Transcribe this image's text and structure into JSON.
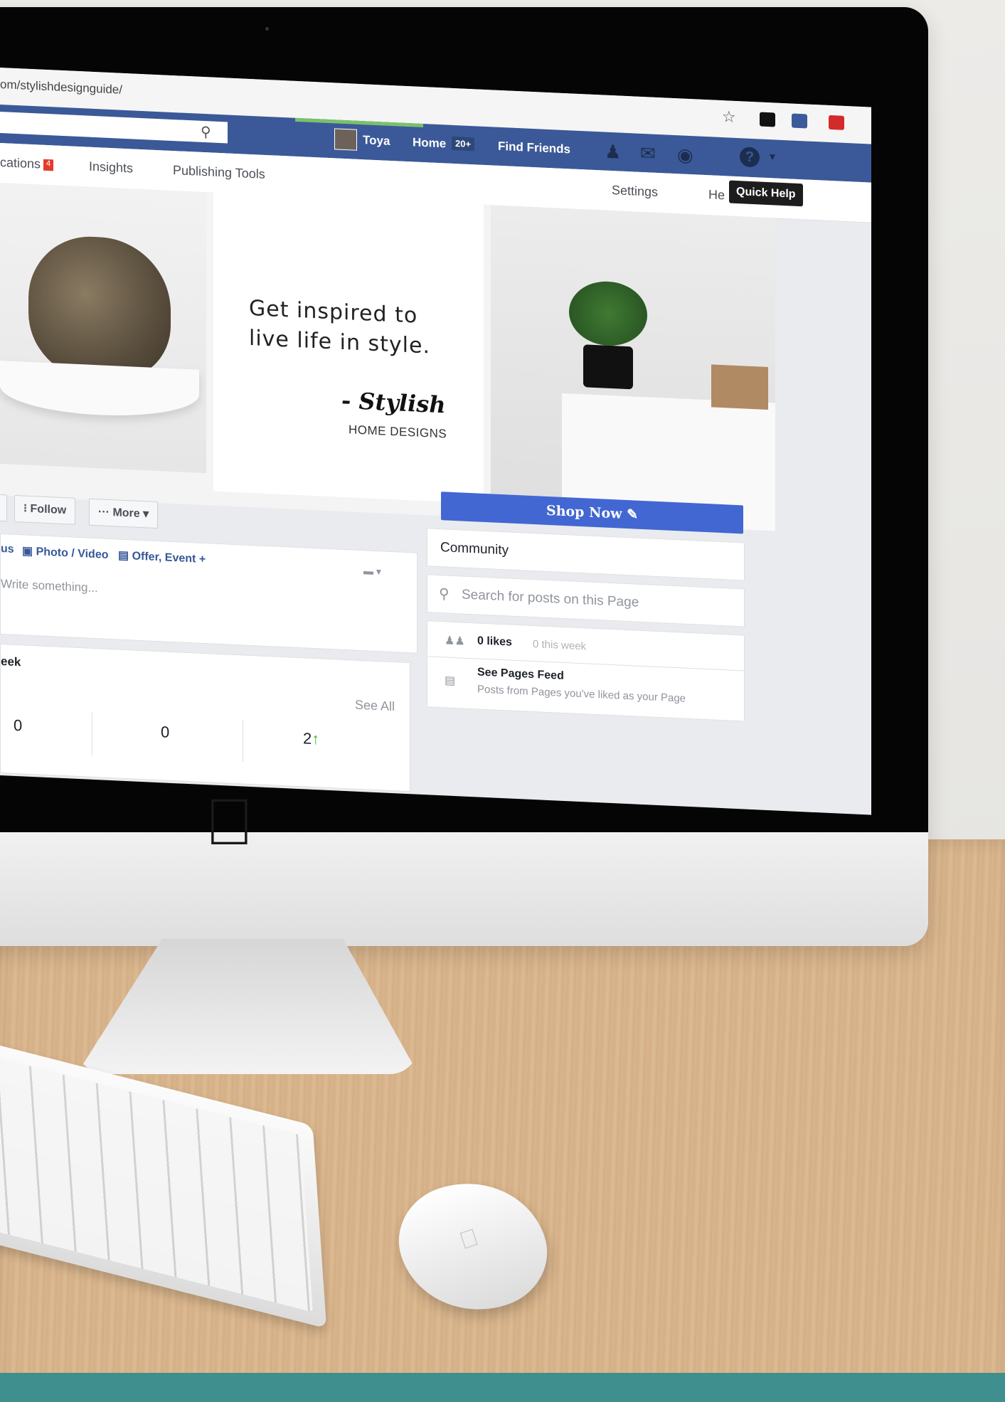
{
  "browser": {
    "url": "om/stylishdesignguide/"
  },
  "fb_header": {
    "user_name": "Toya",
    "home_label": "Home",
    "home_badge": "20+",
    "find_friends_label": "Find Friends"
  },
  "page_nav": {
    "items": [
      "cations",
      "Insights",
      "Publishing Tools"
    ],
    "notifications_badge": "4",
    "settings_label": "Settings",
    "help_label": "He",
    "tooltip": "Quick Help"
  },
  "cover": {
    "tagline": "Get inspired to\nlive life in style.",
    "signature": "- Stylish",
    "signature_sub": "HOME DESIGNS"
  },
  "actions": {
    "partial_label": "e",
    "follow_label": "Follow",
    "more_label": "More",
    "shop_now_label": "Shop Now"
  },
  "composer": {
    "tabs": [
      "us",
      "Photo / Video",
      "Offer, Event +"
    ],
    "placeholder": "Write something..."
  },
  "week_card": {
    "title": "eek",
    "see_all": "See All",
    "stats": [
      "0",
      "0",
      "2"
    ],
    "trend_arrow": "↑"
  },
  "sidebar": {
    "community_label": "Community",
    "search_placeholder": "Search for posts on this Page",
    "likes_count": "0 likes",
    "likes_week": "0 this week",
    "feed_title": "See Pages Feed",
    "feed_subtitle": "Posts from Pages you've liked as your Page"
  },
  "colors": {
    "facebook_blue": "#3b5998",
    "shop_now_blue": "#4267d2",
    "notification_red": "#e43b2c"
  }
}
